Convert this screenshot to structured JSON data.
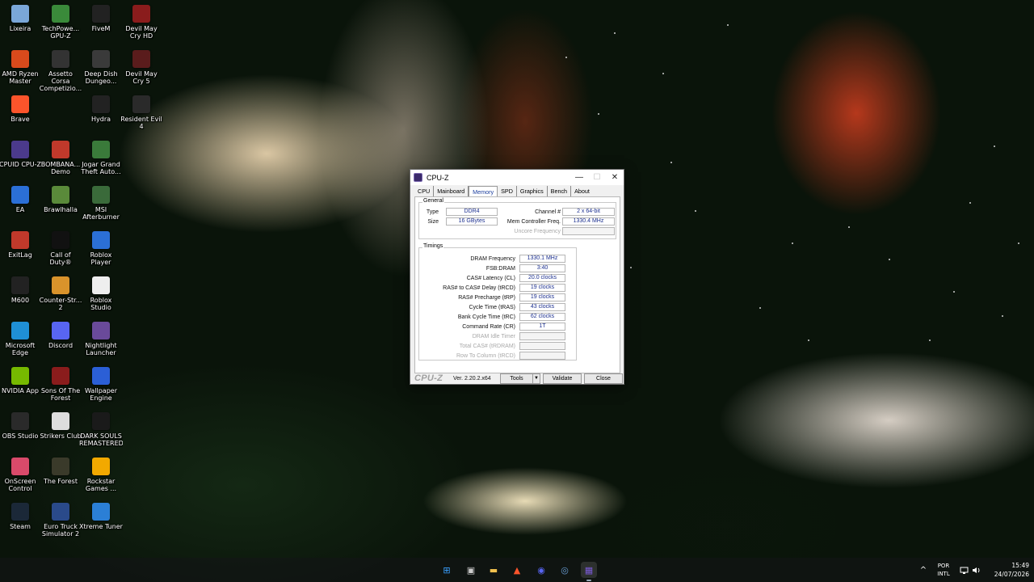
{
  "desktop": {
    "icons": [
      {
        "label": "Lixeira",
        "icon": "recycle-bin-icon",
        "color": "#7aa7d8"
      },
      {
        "label": "TechPowe... GPU-Z",
        "icon": "gpu-z-icon",
        "color": "#3a8a3a"
      },
      {
        "label": "FiveM",
        "icon": "fivem-icon",
        "color": "#222222"
      },
      {
        "label": "Devil May Cry HD",
        "icon": "devil-may-cry-icon",
        "color": "#8a1c1c"
      },
      {
        "label": "AMD Ryzen Master",
        "icon": "amd-ryzen-master-icon",
        "color": "#d94a1c"
      },
      {
        "label": "Assetto Corsa Competizio...",
        "icon": "assetto-corsa-icon",
        "color": "#333333"
      },
      {
        "label": "Deep Dish Dungeo...",
        "icon": "deep-dish-dungeon-icon",
        "color": "#3a3a3a"
      },
      {
        "label": "Devil May Cry 5",
        "icon": "devil-may-cry-5-icon",
        "color": "#5a1c1c"
      },
      {
        "label": "Brave",
        "icon": "brave-icon",
        "color": "#fb542b"
      },
      {
        "label": "Hydra",
        "icon": "hydra-icon",
        "color": "#222222"
      },
      {
        "label": "Resident Evil 4",
        "icon": "resident-evil-4-icon",
        "color": "#2a2a2a"
      },
      {
        "label": "CPUID CPU-Z",
        "icon": "cpu-z-icon",
        "color": "#4b3a8c"
      },
      {
        "label": "BOMBANA... Demo",
        "icon": "bombana-icon",
        "color": "#c0392b"
      },
      {
        "label": "Jogar Grand Theft Auto...",
        "icon": "gta-icon",
        "color": "#3a7a3a"
      },
      {
        "label": "EA",
        "icon": "ea-icon",
        "color": "#2b6fd6"
      },
      {
        "label": "Brawlhalla",
        "icon": "brawlhalla-icon",
        "color": "#5a8a3a"
      },
      {
        "label": "MSI Afterburner",
        "icon": "msi-afterburner-icon",
        "color": "#3a6a3a"
      },
      {
        "label": "ExitLag",
        "icon": "exitlag-icon",
        "color": "#c0392b"
      },
      {
        "label": "Call of Duty®",
        "icon": "call-of-duty-icon",
        "color": "#111111"
      },
      {
        "label": "Roblox Player",
        "icon": "roblox-player-icon",
        "color": "#2b6fd6"
      },
      {
        "label": "M600",
        "icon": "m600-icon",
        "color": "#222222"
      },
      {
        "label": "Counter-Str... 2",
        "icon": "counter-strike-icon",
        "color": "#d9932b"
      },
      {
        "label": "Roblox Studio",
        "icon": "roblox-studio-icon",
        "color": "#eeeeee"
      },
      {
        "label": "Microsoft Edge",
        "icon": "edge-icon",
        "color": "#1f8fd6"
      },
      {
        "label": "Discord",
        "icon": "discord-icon",
        "color": "#5865f2"
      },
      {
        "label": "Nightlight Launcher",
        "icon": "nightlight-icon",
        "color": "#6a4a9a"
      },
      {
        "label": "NVIDIA App",
        "icon": "nvidia-icon",
        "color": "#76b900"
      },
      {
        "label": "Sons Of The Forest",
        "icon": "sons-of-the-forest-icon",
        "color": "#8a1c1c"
      },
      {
        "label": "Wallpaper Engine",
        "icon": "wallpaper-engine-icon",
        "color": "#2b5fd6"
      },
      {
        "label": "OBS Studio",
        "icon": "obs-icon",
        "color": "#2a2a2a"
      },
      {
        "label": "Strikers Club",
        "icon": "strikers-club-icon",
        "color": "#dddddd"
      },
      {
        "label": "DARK SOULS REMASTERED",
        "icon": "dark-souls-icon",
        "color": "#1a1a1a"
      },
      {
        "label": "OnScreen Control",
        "icon": "onscreen-control-icon",
        "color": "#d94a6a"
      },
      {
        "label": "The Forest",
        "icon": "the-forest-icon",
        "color": "#3a3a2a"
      },
      {
        "label": "Rockstar Games ...",
        "icon": "rockstar-icon",
        "color": "#f2a900"
      },
      {
        "label": "Steam",
        "icon": "steam-icon",
        "color": "#1b2838"
      },
      {
        "label": "Euro Truck Simulator 2",
        "icon": "euro-truck-icon",
        "color": "#2a4a8a"
      },
      {
        "label": "Xtreme Tuner",
        "icon": "xtreme-tuner-icon",
        "color": "#2b7fd6"
      }
    ]
  },
  "window": {
    "title": "CPU-Z",
    "controls": {
      "minimize": "—",
      "maximize": "☐",
      "close": "✕"
    },
    "tabs": [
      "CPU",
      "Mainboard",
      "Memory",
      "SPD",
      "Graphics",
      "Bench",
      "About"
    ],
    "active_tab": "Memory",
    "general": {
      "title": "General",
      "type_label": "Type",
      "type_value": "DDR4",
      "size_label": "Size",
      "size_value": "16 GBytes",
      "channel_label": "Channel #",
      "channel_value": "2 x 64-bit",
      "mem_ctrl_label": "Mem Controller Freq.",
      "mem_ctrl_value": "1330.4 MHz",
      "uncore_label": "Uncore Frequency",
      "uncore_value": ""
    },
    "timings": {
      "title": "Timings",
      "rows": [
        {
          "label": "DRAM Frequency",
          "value": "1330.1 MHz",
          "disabled": false
        },
        {
          "label": "FSB:DRAM",
          "value": "3:40",
          "disabled": false
        },
        {
          "label": "CAS# Latency (CL)",
          "value": "20.0 clocks",
          "disabled": false
        },
        {
          "label": "RAS# to CAS# Delay (tRCD)",
          "value": "19 clocks",
          "disabled": false
        },
        {
          "label": "RAS# Precharge (tRP)",
          "value": "19 clocks",
          "disabled": false
        },
        {
          "label": "Cycle Time (tRAS)",
          "value": "43 clocks",
          "disabled": false
        },
        {
          "label": "Bank Cycle Time (tRC)",
          "value": "62 clocks",
          "disabled": false
        },
        {
          "label": "Command Rate (CR)",
          "value": "1T",
          "disabled": false
        },
        {
          "label": "DRAM Idle Timer",
          "value": "",
          "disabled": true
        },
        {
          "label": "Total CAS# (tRDRAM)",
          "value": "",
          "disabled": true
        },
        {
          "label": "Row To Column (tRCD)",
          "value": "",
          "disabled": true
        }
      ]
    },
    "footer": {
      "brand": "CPU-Z",
      "version": "Ver. 2.20.2.x64",
      "tools_label": "Tools",
      "tools_arrow": "▼",
      "validate_label": "Validate",
      "close_label": "Close"
    }
  },
  "taskbar": {
    "apps": [
      {
        "name": "windows-start-icon",
        "glyph": "⊞",
        "color": "#3aa0ff",
        "active": false
      },
      {
        "name": "task-view-icon",
        "glyph": "▣",
        "color": "#cccccc",
        "active": false
      },
      {
        "name": "file-explorer-icon",
        "glyph": "▬",
        "color": "#f2c14e",
        "active": false
      },
      {
        "name": "brave-icon",
        "glyph": "▲",
        "color": "#fb542b",
        "active": false
      },
      {
        "name": "discord-icon",
        "glyph": "◉",
        "color": "#5865f2",
        "active": false
      },
      {
        "name": "steam-icon",
        "glyph": "◎",
        "color": "#6a9fd6",
        "active": false
      },
      {
        "name": "cpu-z-icon",
        "glyph": "▦",
        "color": "#7a5ad6",
        "active": true
      }
    ],
    "tray_chevron": "^",
    "language_line1": "POR",
    "language_line2": "INTL",
    "time": "15:49",
    "date": "24/07/2026"
  }
}
